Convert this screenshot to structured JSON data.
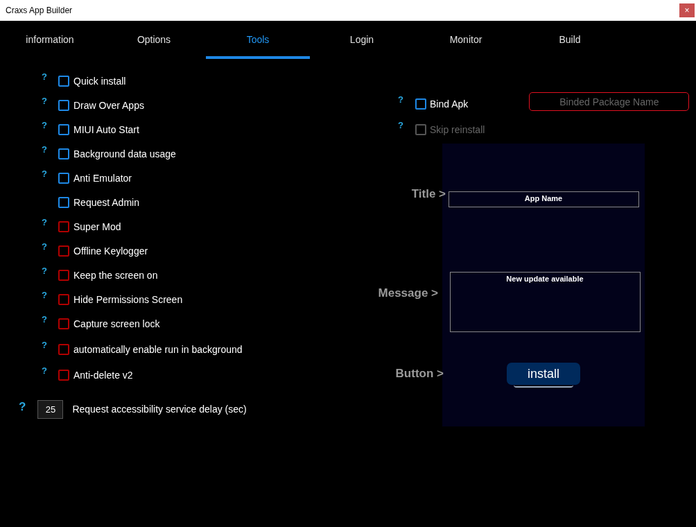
{
  "window": {
    "title": "Craxs App Builder",
    "close": "×"
  },
  "tabs": [
    {
      "label": "information",
      "selected": false
    },
    {
      "label": "Options",
      "selected": false
    },
    {
      "label": "Tools",
      "selected": true
    },
    {
      "label": "Login",
      "selected": false
    },
    {
      "label": "Monitor",
      "selected": false
    },
    {
      "label": "Build",
      "selected": false
    }
  ],
  "options": [
    {
      "label": "Quick install",
      "help": "?",
      "checked": false,
      "color": "#1e88e5"
    },
    {
      "label": "Draw Over Apps",
      "help": "?",
      "checked": false,
      "color": "#1e88e5"
    },
    {
      "label": "MIUI Auto Start",
      "help": "?",
      "checked": false,
      "color": "#1e88e5"
    },
    {
      "label": "Background data usage",
      "help": "?",
      "checked": false,
      "color": "#1e88e5"
    },
    {
      "label": "Anti Emulator",
      "help": "?",
      "checked": false,
      "color": "#1e88e5"
    },
    {
      "label": "Request Admin",
      "checked": false,
      "color": "#1e88e5"
    },
    {
      "label": "Super Mod",
      "help": "?",
      "checked": false,
      "color": "#b00000"
    },
    {
      "label": "Offline Keylogger",
      "help": "?",
      "checked": false,
      "color": "#b00000"
    },
    {
      "label": "Keep the screen on",
      "help": "?",
      "checked": false,
      "color": "#b00000"
    },
    {
      "label": "Hide Permissions Screen",
      "help": "?",
      "checked": false,
      "color": "#b00000"
    },
    {
      "label": "Capture screen lock",
      "help": "?",
      "checked": false,
      "color": "#b00000"
    },
    {
      "label": "automatically enable run in background",
      "help": "?",
      "checked": false,
      "color": "#b00000"
    },
    {
      "label": "Anti-delete v2",
      "help": "?",
      "checked": false,
      "color": "#b00000"
    }
  ],
  "delay": {
    "help": "?",
    "value": "25",
    "label": "Request accessibility service delay (sec)"
  },
  "bind": [
    {
      "label": "Bind Apk",
      "help": "?",
      "checked": false,
      "disabled": false
    },
    {
      "label": "Skip reinstall",
      "help": "?",
      "checked": false,
      "disabled": true
    }
  ],
  "package_field": {
    "placeholder": "Binded Package Name"
  },
  "preview": {
    "title_label": "Title >",
    "title_value": "App Name",
    "message_label": "Message >",
    "message_value": "New update available",
    "button_label": "Button >",
    "button_text": "install"
  }
}
